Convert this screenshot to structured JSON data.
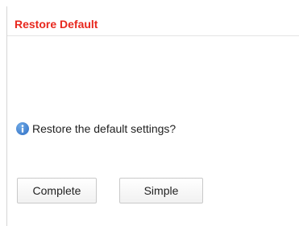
{
  "dialog": {
    "title": "Restore Default",
    "message": "Restore the default settings?",
    "icon": "info-icon"
  },
  "buttons": {
    "complete_label": "Complete",
    "simple_label": "Simple"
  },
  "colors": {
    "title": "#e8281e",
    "info_icon": "#3b7fd0",
    "button_border": "#c9c9c9"
  }
}
